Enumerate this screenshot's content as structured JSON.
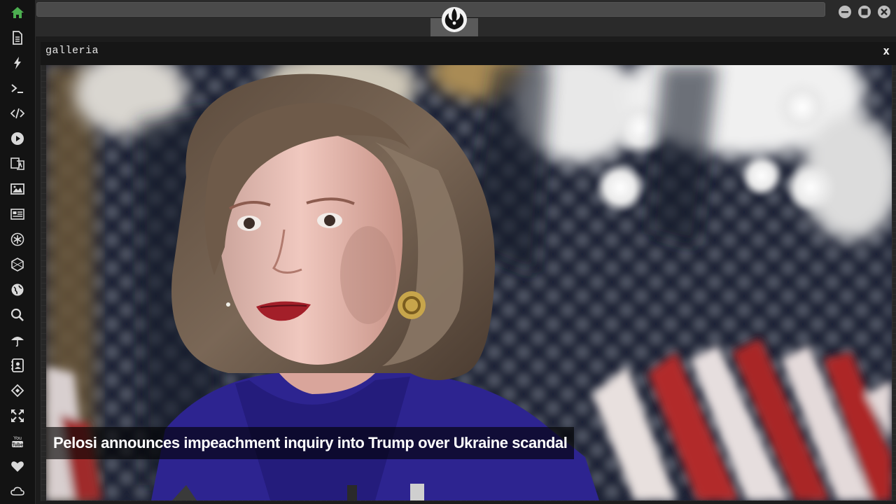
{
  "sidebar": {
    "items": [
      {
        "icon": "home-icon",
        "color": "#4caf50"
      },
      {
        "icon": "document-icon"
      },
      {
        "icon": "lightning-icon"
      },
      {
        "icon": "terminal-icon"
      },
      {
        "icon": "code-icon"
      },
      {
        "icon": "play-icon"
      },
      {
        "icon": "translate-icon"
      },
      {
        "icon": "image-icon"
      },
      {
        "icon": "newspaper-icon"
      },
      {
        "icon": "asterisk-icon"
      },
      {
        "icon": "hexagon-icon"
      },
      {
        "icon": "globe-icon"
      },
      {
        "icon": "search-icon"
      },
      {
        "icon": "umbrella-icon"
      },
      {
        "icon": "contact-card-icon"
      },
      {
        "icon": "link-icon"
      },
      {
        "icon": "expand-icon"
      },
      {
        "icon": "youtube-icon"
      },
      {
        "icon": "heart-icon"
      },
      {
        "icon": "cloud-icon"
      }
    ]
  },
  "topbar": {
    "logo": "rebel-alliance-icon",
    "controls": [
      "minimize-icon",
      "maximize-icon",
      "close-icon"
    ]
  },
  "galleria": {
    "title": "galleria",
    "close_label": "x",
    "caption": "Pelosi announces impeachment inquiry into Trump over Ukraine scandal"
  },
  "colors": {
    "accent": "#4caf50",
    "icon": "#d9d9d9",
    "panel_header": "#161616"
  }
}
